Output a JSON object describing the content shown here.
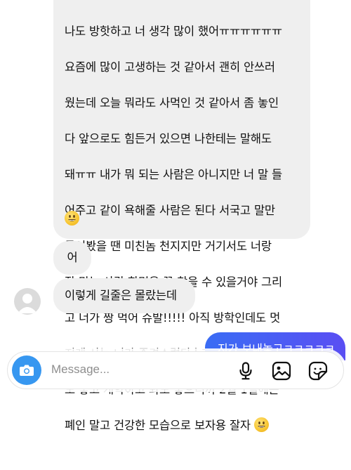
{
  "messages": [
    {
      "id": "msg1",
      "direction": "incoming",
      "text": "나도 방핫하고 너 생각 많이 했어ㅠㅠㅠㅠㅠㅠ 요즘에 많이 고생하는 것 같아서 괜히 안쓰러웠는데 오늘 뭐라도 사먹인 것 같아서 좀 놓인다 앞으로도 힘든거 있으면 나한테는 말해도 돼ㅠㅠ 내가 뭐 되는 사람은 아니지만 너 말 들어주고 같이 욕해줄 사람은 된다 서국고 말만 들어봤을 땐 미친놈 천지지만 거기서도 너랑 잘 맞는 사람 한명은 꼭 찾을 수 있을거야 그리고 너가 짱 먹어 슈발!!!!! 아직 방학인데도 멋지게 사는 너가 존경스럽다ㅏ개학 전에 또 봐도 좋고 개학하고 봐도 좋으니까 2월 1일에는 폐인 말고 건강한 모습으로 보자용 잘자",
      "lines": [
        "나도 방핫하고 너 생각 많이 했어ㅠㅠㅠㅠㅠㅠ",
        "요즘에 많이 고생하는 것 같아서 괜히 안쓰러",
        "웠는데 오늘 뭐라도 사먹인 것 같아서 좀 놓인",
        "다 앞으로도 힘든거 있으면 나한테는 말해도",
        "돼ㅠㅠ 내가 뭐 되는 사람은 아니지만 너 말 들",
        "어주고 같이 욕해줄 사람은 된다 서국고 말만",
        "들어봤을 땐 미친놈 천지지만 거기서도 너랑",
        "잘 맞는 사람 한명은 꼭 찾을 수 있을거야 그리",
        "고 너가 짱 먹어 슈발!!!!! 아직 방학인데도 멋",
        "지게 사는 너가 존경스럽다ㅏ개학 전에 또 봐",
        "도 좋고 개학하고 봐도 좋으니까 2월 1일에는",
        "폐인 말고 건강한 모습으로 보자용 잘자"
      ],
      "emoji": "grinning-face-emoji"
    },
    {
      "id": "msg2",
      "direction": "incoming",
      "text": "어"
    },
    {
      "id": "msg3",
      "direction": "incoming",
      "text": "이렇게 길줄은 몰랐는데"
    },
    {
      "id": "msg4",
      "direction": "outgoing",
      "text": "지가 보내놓고ㅋㅋㅋㅋㅋ"
    }
  ],
  "composer": {
    "placeholder": "Message...",
    "camera_icon": "camera-icon",
    "mic_icon": "microphone-icon",
    "gallery_icon": "image-gallery-icon",
    "sticker_icon": "sticker-icon"
  },
  "colors": {
    "incoming_bubble": "#efefef",
    "outgoing_gradient_start": "#3a6cf4",
    "outgoing_gradient_end": "#5a4ef3",
    "camera_button": "#3797f0"
  }
}
